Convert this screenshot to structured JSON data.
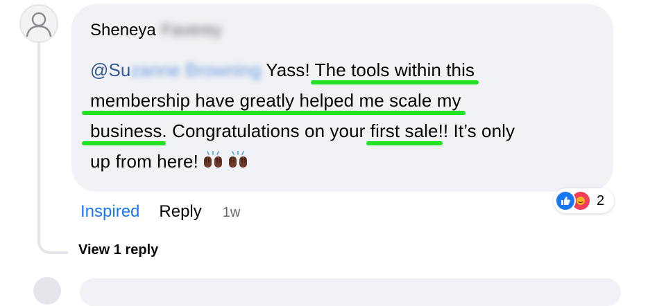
{
  "comment": {
    "author_first": "Sheneya",
    "author_last": "Faverey",
    "mention_visible": "@Su",
    "mention_blurred": "zanne Browning",
    "lines": [
      {
        "pre": "Yass! ",
        "hl": "The tools within this"
      },
      {
        "hl": "membership have greatly helped me scale my"
      },
      {
        "hl": "business",
        "mid": ". Congratulations on your ",
        "hl2": "first sale",
        "post": "!! It’s only"
      },
      {
        "pre": "up from here!"
      }
    ],
    "emoji_names": [
      "raising-hands-icon",
      "raising-hands-icon"
    ]
  },
  "reactions": {
    "icons": [
      "like-icon",
      "care-icon"
    ],
    "count": "2"
  },
  "actions": {
    "inspired_label": "Inspired",
    "reply_label": "Reply",
    "time": "1w"
  },
  "replies": {
    "view_label": "View 1 reply"
  },
  "colors": {
    "bubble": "#f0f2f5",
    "highlight": "#22e21f",
    "link": "#1877f2",
    "mention": "#385898"
  }
}
